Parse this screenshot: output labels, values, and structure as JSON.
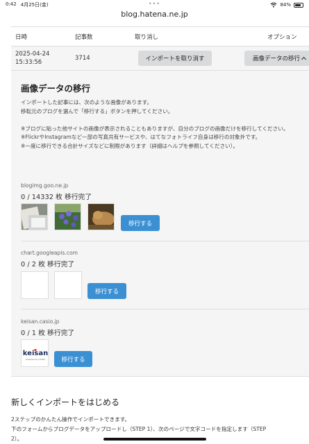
{
  "status": {
    "time": "0:42",
    "date": "4月25日(金)",
    "battery": "84%",
    "battery_level": 0.84
  },
  "browser": {
    "url": "blog.hatena.ne.jp"
  },
  "table": {
    "headers": {
      "date": "日時",
      "count": "記事数",
      "cancel": "取り消し",
      "option": "オプション"
    },
    "row": {
      "date_line1": "2025-04-24",
      "date_line2": "15:33:56",
      "count": "3714",
      "cancel_button": "インポートを取り消す",
      "migrate_button": "画像データの移行"
    }
  },
  "migration": {
    "title": "画像データの移行",
    "intro_line1": "インポートした記事には、次のような画像があります。",
    "intro_line2": "移転元のブログを選んで「移行する」ボタンを押してください。",
    "note1": "※ブログに貼った他サイトの画像が表示されることもありますが、自分のブログの画像だけを移行してください。",
    "note2": "※FlickrやInstagramなど一部の写真共有サービスや、はてなフォトライフ自身は移行の対象外です。",
    "note3": "※一度に移行できる合計サイズなどに制限があります（詳細はヘルプを参照してください）。",
    "sources": [
      {
        "host": "blogimg.goo.ne.jp",
        "progress": "0 / 14332 枚 移行完了",
        "button": "移行する"
      },
      {
        "host": "chart.googleapis.com",
        "progress": "0 / 2 枚 移行完了",
        "button": "移行する"
      },
      {
        "host": "keisan.casio.jp",
        "progress": "0 / 1 枚 移行完了",
        "button": "移行する",
        "logo_text": "keisan",
        "logo_sub": "Powered by CASIO"
      }
    ]
  },
  "new_import": {
    "title": "新しくインポートをはじめる",
    "line1": "2ステップのかんたん操作でインポートできます。",
    "line2": "下のフォームからブログデータをアップロードし（STEP 1）、次のページで文字コードを指定します（STEP",
    "line3": "2）。"
  },
  "colors": {
    "accent": "#3b8fd3",
    "panel_bg": "#f5f5f5",
    "button_grey": "#d9dadc"
  }
}
